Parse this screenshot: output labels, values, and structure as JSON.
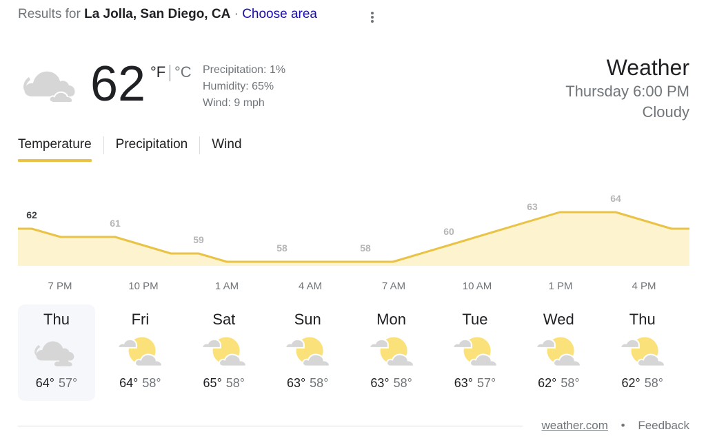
{
  "header": {
    "results_prefix": "Results for",
    "location": "La Jolla, San Diego, CA",
    "separator": "·",
    "choose_area": "Choose area",
    "more_icon": "more-vert-icon"
  },
  "current": {
    "icon": "cloudy-icon",
    "temperature": "62",
    "unit_f": "°F",
    "unit_c": "°C",
    "precipitation": "Precipitation: 1%",
    "humidity": "Humidity: 65%",
    "wind": "Wind: 9 mph",
    "title": "Weather",
    "datetime": "Thursday 6:00 PM",
    "condition": "Cloudy"
  },
  "tabs": [
    {
      "label": "Temperature",
      "active": true
    },
    {
      "label": "Precipitation",
      "active": false
    },
    {
      "label": "Wind",
      "active": false
    }
  ],
  "colors": {
    "accent": "#e9c345",
    "area_fill": "#fdf3cf",
    "link": "#1a0dab",
    "secondary_text": "#70757a"
  },
  "chart_data": {
    "type": "area",
    "title": "Temperature",
    "unit": "°F",
    "hourly": [
      62,
      62,
      61,
      61,
      61,
      60,
      59,
      59,
      58,
      58,
      58,
      58,
      58,
      58,
      58,
      59,
      60,
      61,
      62,
      63,
      63,
      64,
      63,
      62
    ],
    "hourly_values_exact": [
      62,
      61,
      61,
      61,
      60,
      59,
      59,
      58,
      58,
      58,
      58,
      58,
      58,
      58,
      59,
      60,
      61,
      62,
      63,
      63,
      63,
      63,
      62,
      62
    ],
    "value_labels": [
      {
        "label": "62",
        "current": true
      },
      {
        "label": "61",
        "current": false
      },
      {
        "label": "59",
        "current": false
      },
      {
        "label": "58",
        "current": false
      },
      {
        "label": "58",
        "current": false
      },
      {
        "label": "60",
        "current": false
      },
      {
        "label": "63",
        "current": false
      },
      {
        "label": "64",
        "current": false
      }
    ],
    "x_ticks": [
      "7 PM",
      "10 PM",
      "1 AM",
      "4 AM",
      "7 AM",
      "10 AM",
      "1 PM",
      "4 PM"
    ],
    "ylim": [
      57.5,
      64
    ]
  },
  "forecast": [
    {
      "day": "Thu",
      "icon": "cloudy-icon",
      "high": "64°",
      "low": "57°",
      "selected": true
    },
    {
      "day": "Fri",
      "icon": "partly-cloudy-icon",
      "high": "64°",
      "low": "58°",
      "selected": false
    },
    {
      "day": "Sat",
      "icon": "partly-cloudy-icon",
      "high": "65°",
      "low": "58°",
      "selected": false
    },
    {
      "day": "Sun",
      "icon": "partly-cloudy-icon",
      "high": "63°",
      "low": "58°",
      "selected": false
    },
    {
      "day": "Mon",
      "icon": "partly-cloudy-icon",
      "high": "63°",
      "low": "58°",
      "selected": false
    },
    {
      "day": "Tue",
      "icon": "partly-cloudy-icon",
      "high": "63°",
      "low": "57°",
      "selected": false
    },
    {
      "day": "Wed",
      "icon": "partly-cloudy-icon",
      "high": "62°",
      "low": "58°",
      "selected": false
    },
    {
      "day": "Thu",
      "icon": "partly-cloudy-icon",
      "high": "62°",
      "low": "58°",
      "selected": false
    }
  ],
  "footer": {
    "source": "weather.com",
    "dot": "•",
    "feedback": "Feedback"
  }
}
